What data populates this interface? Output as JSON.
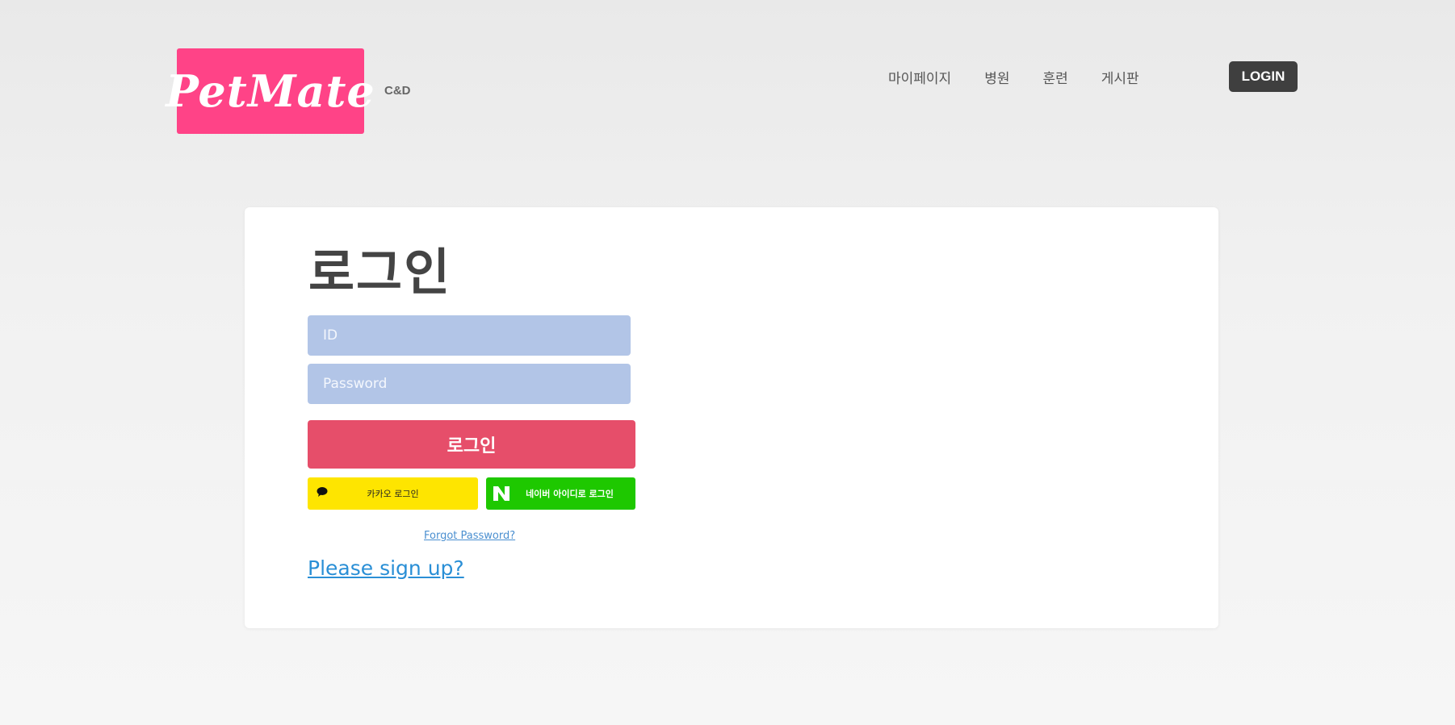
{
  "brand": {
    "logo_text": "PetMate",
    "sub_text": "C&D",
    "logo_color": "#ff4387"
  },
  "nav": {
    "items": [
      {
        "label": "마이페이지"
      },
      {
        "label": "병원"
      },
      {
        "label": "훈련"
      },
      {
        "label": "게시판"
      }
    ],
    "login_label": "LOGIN"
  },
  "login_form": {
    "title": "로그인",
    "id_placeholder": "ID",
    "password_placeholder": "Password",
    "submit_label": "로그인",
    "kakao_label": "카카오 로그인",
    "naver_label": "네이버 아이디로 로그인",
    "forgot_label": "Forgot Password?",
    "signup_label": "Please sign up?"
  },
  "colors": {
    "input_bg": "#b2c5e7",
    "submit_bg": "#e64e6a",
    "kakao_bg": "#fee500",
    "naver_bg": "#1ec800",
    "nav_login_bg": "#3f3f3f"
  }
}
